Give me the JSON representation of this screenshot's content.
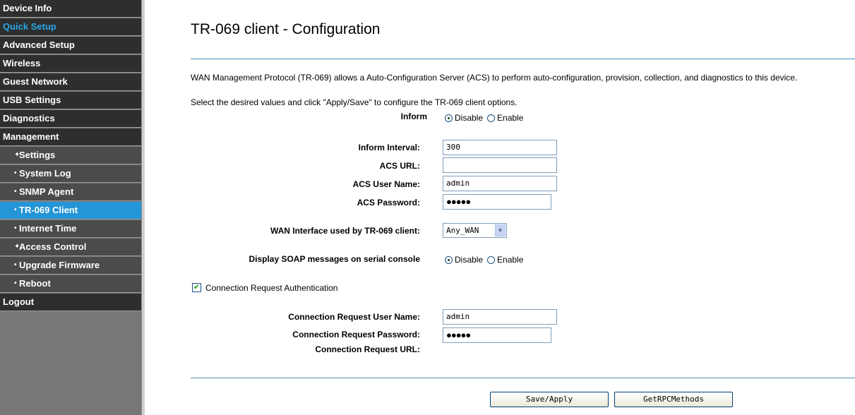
{
  "sidebar": {
    "items": [
      {
        "label": "Device Info"
      },
      {
        "label": "Quick Setup"
      },
      {
        "label": "Advanced Setup"
      },
      {
        "label": "Wireless"
      },
      {
        "label": "Guest Network"
      },
      {
        "label": "USB Settings"
      },
      {
        "label": "Diagnostics"
      },
      {
        "label": "Management"
      },
      {
        "label": "Settings"
      },
      {
        "label": "System Log"
      },
      {
        "label": "SNMP Agent"
      },
      {
        "label": "TR-069 Client"
      },
      {
        "label": "Internet Time"
      },
      {
        "label": "Access Control"
      },
      {
        "label": "Upgrade Firmware"
      },
      {
        "label": "Reboot"
      },
      {
        "label": "Logout"
      }
    ],
    "active_item": "TR-069 Client"
  },
  "page": {
    "title": "TR-069 client - Configuration",
    "description": "WAN Management Protocol (TR-069) allows a Auto-Configuration Server (ACS) to perform auto-configuration, provision, collection, and diagnostics to this device.",
    "instruction": "Select the desired values and click \"Apply/Save\" to configure the TR-069 client options."
  },
  "form": {
    "inform": {
      "label": "Inform",
      "selected": "Disable",
      "options": [
        "Disable",
        "Enable"
      ]
    },
    "inform_interval": {
      "label": "Inform Interval:",
      "value": "300"
    },
    "acs_url": {
      "label": "ACS URL:",
      "value": ""
    },
    "acs_user_name": {
      "label": "ACS User Name:",
      "value": "admin"
    },
    "acs_password": {
      "label": "ACS Password:",
      "value": "●●●●●"
    },
    "wan_interface": {
      "label": "WAN Interface used by TR-069 client:",
      "value": "Any_WAN"
    },
    "soap_messages": {
      "label": "Display SOAP messages on serial console",
      "selected": "Disable",
      "options": [
        "Disable",
        "Enable"
      ]
    },
    "connection_request_auth": {
      "label": "Connection Request Authentication",
      "checked": true
    },
    "cr_user_name": {
      "label": "Connection Request User Name:",
      "value": "admin"
    },
    "cr_password": {
      "label": "Connection Request Password:",
      "value": "●●●●●"
    },
    "cr_url": {
      "label": "Connection Request URL:",
      "value": ""
    }
  },
  "buttons": {
    "save_apply": "Save/Apply",
    "get_rpc_methods": "GetRPCMethods"
  },
  "colors": {
    "sidebar_item_bg": "#2e2e2e",
    "sidebar_sub_bg": "#4b4b4b",
    "active_bg": "#2495d6",
    "quick_setup_text": "#2aa6e6",
    "rule": "#4e8fb8"
  }
}
